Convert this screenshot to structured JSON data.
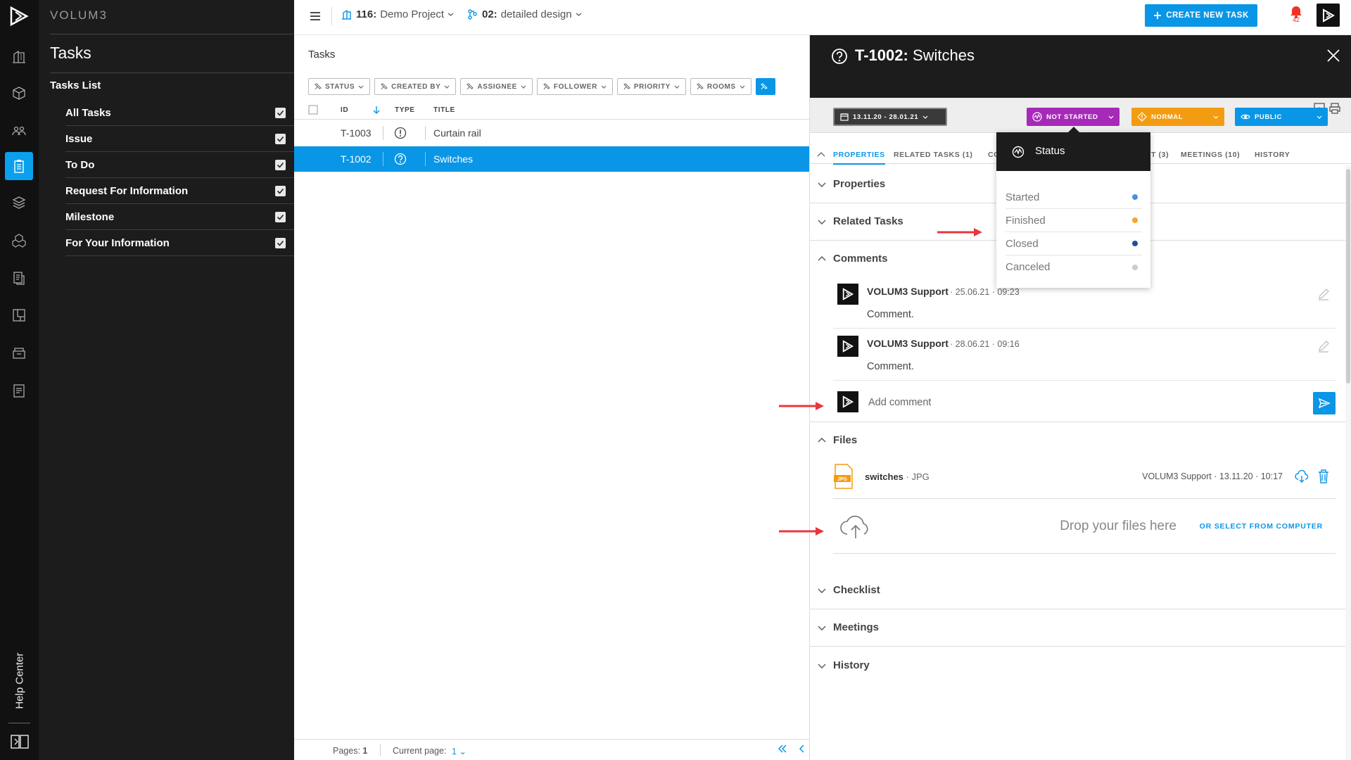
{
  "app": {
    "brand": "VOLUM3"
  },
  "rail": {
    "help_label": "Help Center"
  },
  "sidebar": {
    "title": "Tasks",
    "list_heading": "Tasks List",
    "items": [
      {
        "label": "All Tasks",
        "checked": true
      },
      {
        "label": "Issue",
        "checked": true
      },
      {
        "label": "To Do",
        "checked": true
      },
      {
        "label": "Request For Information",
        "checked": true
      },
      {
        "label": "Milestone",
        "checked": true
      },
      {
        "label": "For Your Information",
        "checked": true
      }
    ]
  },
  "topbar": {
    "project_id": "116:",
    "project_name": "Demo Project",
    "phase_id": "02:",
    "phase_name": "detailed design",
    "create_label": "CREATE NEW TASK",
    "notifications": "42"
  },
  "tasks": {
    "title": "Tasks",
    "filters": [
      "STATUS",
      "CREATED BY",
      "ASSIGNEE",
      "FOLLOWER",
      "PRIORITY",
      "ROOMS"
    ],
    "columns": {
      "id": "ID",
      "type": "TYPE",
      "title": "TITLE"
    },
    "rows": [
      {
        "id": "T-1003",
        "type_icon": "exclamation-icon",
        "title": "Curtain rail",
        "selected": false
      },
      {
        "id": "T-1002",
        "type_icon": "question-icon",
        "title": "Switches",
        "selected": true
      }
    ],
    "pager": {
      "pages_label": "Pages:",
      "pages": "1",
      "current_label": "Current page:",
      "current": "1"
    }
  },
  "detail": {
    "task_id": "T-1002:",
    "task_title": "Switches",
    "date_range": "13.11.20 - 28.01.21",
    "status": "NOT STARTED",
    "priority": "NORMAL",
    "visibility": "PUBLIC",
    "tabs": [
      "PROPERTIES",
      "RELATED TASKS (1)",
      "CO",
      "T (3)",
      "MEETINGS (10)",
      "HISTORY"
    ],
    "sections": {
      "properties": "Properties",
      "related": "Related Tasks",
      "comments": "Comments",
      "files": "Files",
      "checklist": "Checklist",
      "meetings": "Meetings",
      "history": "History"
    },
    "comments": [
      {
        "author": "VOLUM3 Support",
        "time": "· 25.06.21 · 09:23",
        "text": "Comment."
      },
      {
        "author": "VOLUM3 Support",
        "time": "· 28.06.21 · 09:16",
        "text": "Comment."
      }
    ],
    "add_comment_placeholder": "Add comment",
    "file": {
      "name": "switches",
      "ext": "· JPG",
      "icon_text": "JPG",
      "meta": "VOLUM3 Support · 13.11.20 · 10:17"
    },
    "drop_text": "Drop your files here",
    "select_link": "OR SELECT FROM COMPUTER"
  },
  "status_popup": {
    "title": "Status",
    "options": [
      {
        "label": "Started",
        "color": "#4a90e2"
      },
      {
        "label": "Finished",
        "color": "#f5a623"
      },
      {
        "label": "Closed",
        "color": "#1f4e9c"
      },
      {
        "label": "Canceled",
        "color": "#cccccc"
      }
    ]
  },
  "colors": {
    "accent": "#0a96e6",
    "status": "#a62ab8",
    "priority": "#f39c12",
    "annotation": "#e8383d"
  }
}
